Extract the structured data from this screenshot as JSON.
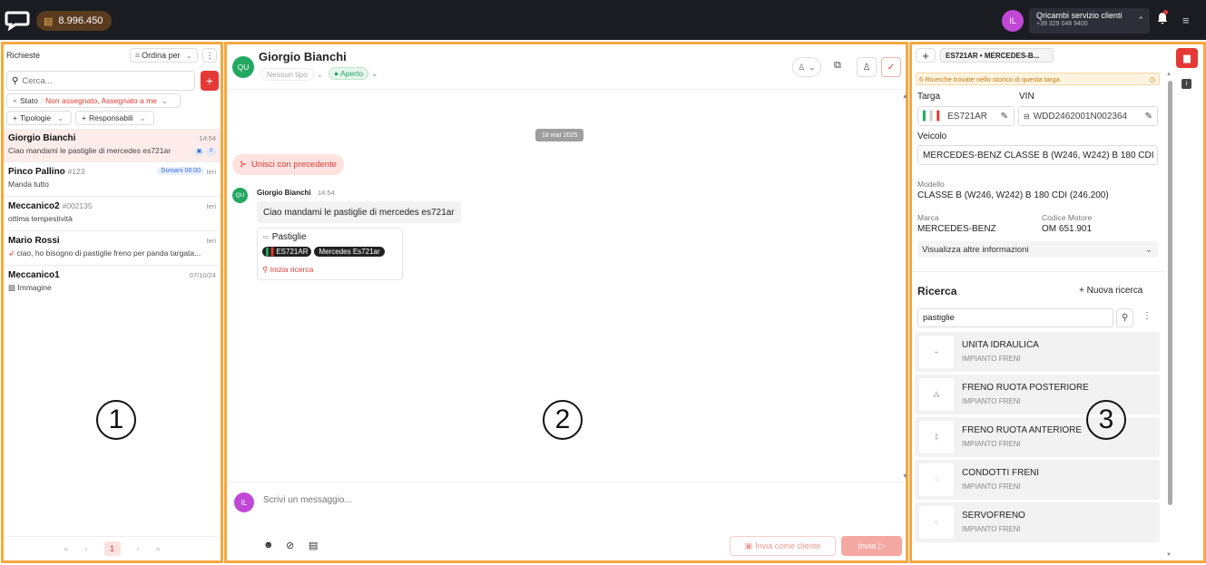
{
  "topbar": {
    "credits": "8.996.450",
    "avatar_initials": "IL",
    "account_name": "Qricambi servizio clienti",
    "account_phone": "+39 329 048 9400"
  },
  "panel_numbers": [
    "1",
    "2",
    "3"
  ],
  "left": {
    "title": "Richieste",
    "sort_label": "Ordina per",
    "search_placeholder": "Cerca...",
    "filter_state_label": "Stato",
    "filter_state_value": "Non assegnato, Assegnato a me",
    "filter_types": "Tipologie",
    "filter_owners": "Responsabili",
    "conversations": [
      {
        "name": "Giorgio Bianchi",
        "sub": "",
        "time": "14:54",
        "preview": "Ciao mandami le pastiglie di mercedes es721ar",
        "tag": ""
      },
      {
        "name": "Pinco Pallino",
        "sub": "#123",
        "time": "Ieri",
        "preview": "Manda tutto",
        "tag": "Domani 08:00"
      },
      {
        "name": "Meccanico2",
        "sub": "#002135",
        "time": "Ieri",
        "preview": "ottima tempestività",
        "tag": ""
      },
      {
        "name": "Mario Rossi",
        "sub": "",
        "time": "Ieri",
        "preview": "ciao, ho bisogno di pastiglie freno per panda targata...",
        "tag": ""
      },
      {
        "name": "Meccanico1",
        "sub": "",
        "time": "07/10/24",
        "preview": "Immagine",
        "tag": ""
      }
    ],
    "pager": {
      "current": "1"
    }
  },
  "chat": {
    "avatar": "QU",
    "name": "Giorgio Bianchi",
    "type": "Nessun tipo",
    "status": "Aperto",
    "date": "18 mar 2025",
    "merge": "Unisci con precedente",
    "msg_author": "Giorgio Bianchi",
    "msg_time": "14:54",
    "msg_text": "Ciao mandami le pastiglie di mercedes es721ar",
    "card_title": "Pastiglie",
    "card_plate": "ES721AR",
    "card_vehicle": "Mercedes Es721ar",
    "card_action": "Inizia ricerca",
    "input_avatar": "IL",
    "input_placeholder": "Scrivi un messaggio...",
    "send_as_client": "Invia come cliente",
    "send": "Invia"
  },
  "right": {
    "vehicle_tab": "ES721AR • MERCEDES-B...",
    "history_notice": "6 Ricerche trovate nello storico di questa targa",
    "targa_label": "Targa",
    "targa": "ES721AR",
    "vin_label": "VIN",
    "vin": "WDD2462001N002364",
    "veicolo_label": "Veicolo",
    "veicolo": "MERCEDES-BENZ CLASSE B (W246, W242) B 180 CDI",
    "modello_label": "Modello",
    "modello": "CLASSE B (W246, W242) B 180 CDI (246.200)",
    "marca_label": "Marca",
    "marca": "MERCEDES-BENZ",
    "motore_label": "Codice Motore",
    "motore": "OM 651.901",
    "more_info": "Visualizza altre informazioni",
    "ricerca_title": "Ricerca",
    "new_search": "+ Nuova ricerca",
    "search_value": "pastiglie",
    "parts": [
      {
        "name": "UNITA IDRAULICA",
        "category": "IMPIANTO FRENI"
      },
      {
        "name": "FRENO RUOTA POSTERIORE",
        "category": "IMPIANTO FRENI"
      },
      {
        "name": "FRENO RUOTA ANTERIORE",
        "category": "IMPIANTO FRENI"
      },
      {
        "name": "CONDOTTI FRENI",
        "category": "IMPIANTO FRENI"
      },
      {
        "name": "SERVOFRENO",
        "category": "IMPIANTO FRENI"
      }
    ]
  },
  "colors": {
    "accent": "#e53935",
    "frame": "#f7a740",
    "topbar": "#1a1c22",
    "green": "#22a861"
  }
}
